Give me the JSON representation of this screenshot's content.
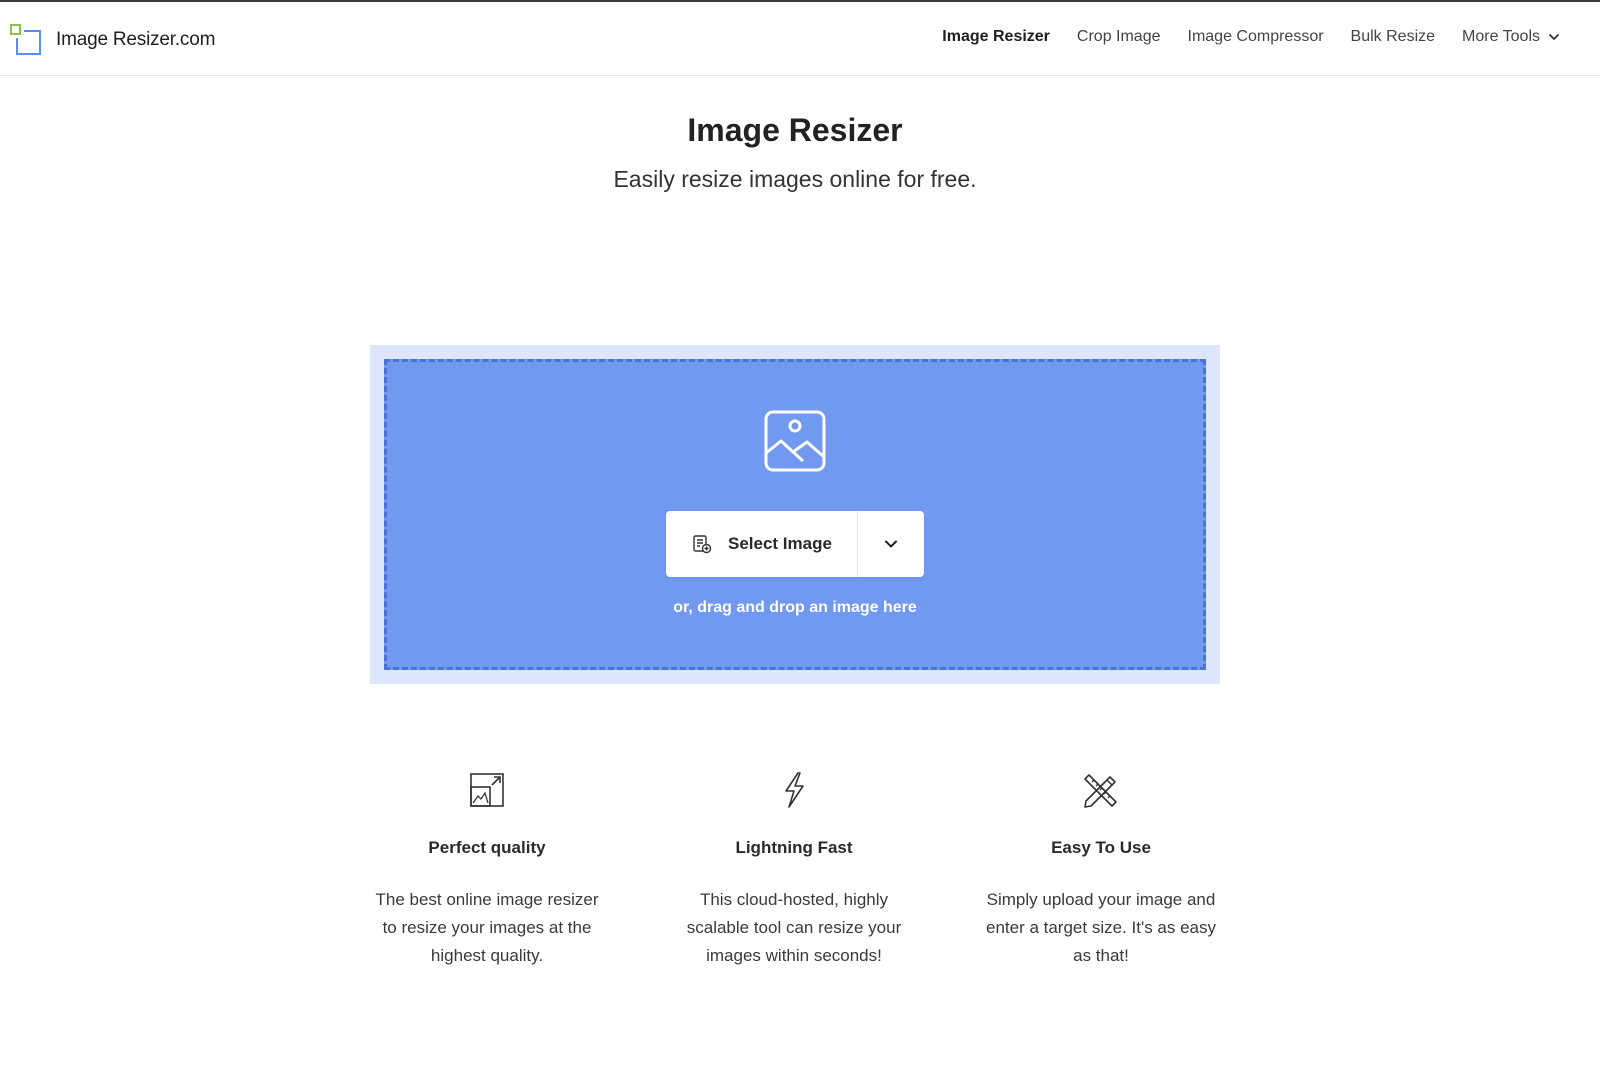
{
  "brand": {
    "name": "Image Resizer.com",
    "logo_colors": {
      "small": "#8cc152",
      "large": "#5b8ee6"
    }
  },
  "nav": {
    "items": [
      {
        "label": "Image Resizer",
        "active": true
      },
      {
        "label": "Crop Image"
      },
      {
        "label": "Image Compressor"
      },
      {
        "label": "Bulk Resize"
      },
      {
        "label": "More Tools",
        "icon": "chevron-down-icon"
      }
    ]
  },
  "hero": {
    "title": "Image Resizer",
    "subtitle": "Easily resize images online for free."
  },
  "dropzone": {
    "icon": "image-placeholder-icon",
    "select_label": "Select Image",
    "select_icon": "file-add-icon",
    "dropdown_icon": "chevron-down-icon",
    "drag_text": "or, drag and drop an image here",
    "colors": {
      "fill": "#7199f0",
      "border": "#4a72d8",
      "frame": "#dde7fb"
    }
  },
  "features": [
    {
      "icon": "resize-image-icon",
      "title": "Perfect quality",
      "lines": [
        "The best online image resizer",
        "to resize your images at the",
        "highest quality."
      ]
    },
    {
      "icon": "lightning-icon",
      "title": "Lightning Fast",
      "lines": [
        "This cloud-hosted, highly",
        "scalable tool can resize your",
        "images within seconds!"
      ]
    },
    {
      "icon": "pencil-ruler-icon",
      "title": "Easy To Use",
      "lines": [
        "Simply upload your image and",
        "enter a target size. It's as easy",
        "as that!"
      ]
    }
  ]
}
